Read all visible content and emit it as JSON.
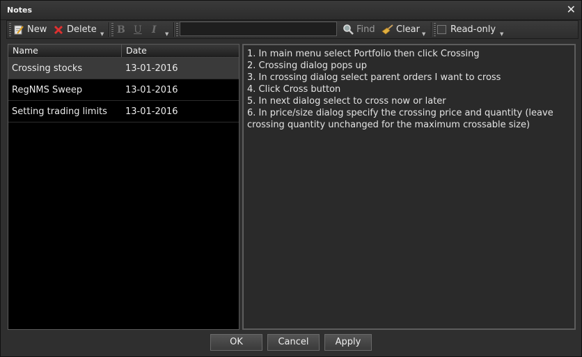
{
  "window": {
    "title": "Notes",
    "close_glyph": "✕"
  },
  "toolbar": {
    "new_label": "New",
    "delete_label": "Delete",
    "bold_label": "B",
    "underline_label": "U",
    "italic_label": "I",
    "search_value": "",
    "find_label": "Find",
    "clear_label": "Clear",
    "readonly_label": "Read-only",
    "readonly_checked": false
  },
  "list": {
    "columns": [
      "Name",
      "Date"
    ],
    "rows": [
      {
        "name": "Crossing stocks",
        "date": "13-01-2016",
        "selected": true
      },
      {
        "name": "RegNMS Sweep",
        "date": "13-01-2016",
        "selected": false
      },
      {
        "name": "Setting trading limits",
        "date": "13-01-2016",
        "selected": false
      }
    ]
  },
  "editor": {
    "lines": [
      "1. In main menu select Portfolio then click Crossing",
      "2. Crossing dialog pops up",
      "3. In crossing dialog select parent orders I want to cross",
      "4. Click Cross button",
      "5. In next dialog select to cross now or later",
      "6. In price/size dialog specify the crossing price and quantity (leave crossing quantity unchanged for the maximum crossable size)"
    ]
  },
  "buttons": {
    "ok": "OK",
    "cancel": "Cancel",
    "apply": "Apply"
  },
  "colors": {
    "delete_icon": "#e03030",
    "clear_icon": "#e0b040",
    "selected_row": "#3a3a3a"
  }
}
